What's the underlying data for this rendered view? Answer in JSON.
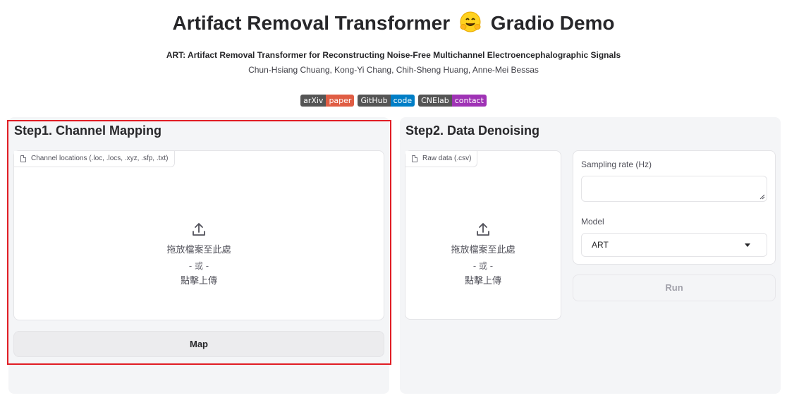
{
  "header": {
    "title_part1": "Artifact Removal Transformer",
    "title_part2": "Gradio Demo",
    "subtitle": "ART: Artifact Removal Transformer for Reconstructing Noise-Free Multichannel Electroencephalographic Signals",
    "authors": "Chun-Hsiang Chuang, Kong-Yi Chang, Chih-Sheng Huang, Anne-Mei Bessas"
  },
  "badges": [
    {
      "left": "arXiv",
      "right": "paper",
      "color": "#e05d44"
    },
    {
      "left": "GitHub",
      "right": "code",
      "color": "#007ec6"
    },
    {
      "left": "CNElab",
      "right": "contact",
      "color": "#9f33b5"
    }
  ],
  "step1": {
    "title": "Step1. Channel Mapping",
    "upload_label": "Channel locations (.loc, .locs, .xyz, .sfp, .txt)",
    "drop_text": "拖放檔案至此處",
    "or_text": "- 或 -",
    "click_text": "點擊上傳",
    "map_button": "Map"
  },
  "step2": {
    "title": "Step2. Data Denoising",
    "upload_label": "Raw data (.csv)",
    "drop_text": "拖放檔案至此處",
    "or_text": "- 或 -",
    "click_text": "點擊上傳",
    "sampling_label": "Sampling rate (Hz)",
    "sampling_value": "",
    "model_label": "Model",
    "model_value": "ART",
    "run_button": "Run"
  },
  "colors": {
    "highlight": "#e11d24",
    "panel_bg": "#f4f5f7"
  }
}
